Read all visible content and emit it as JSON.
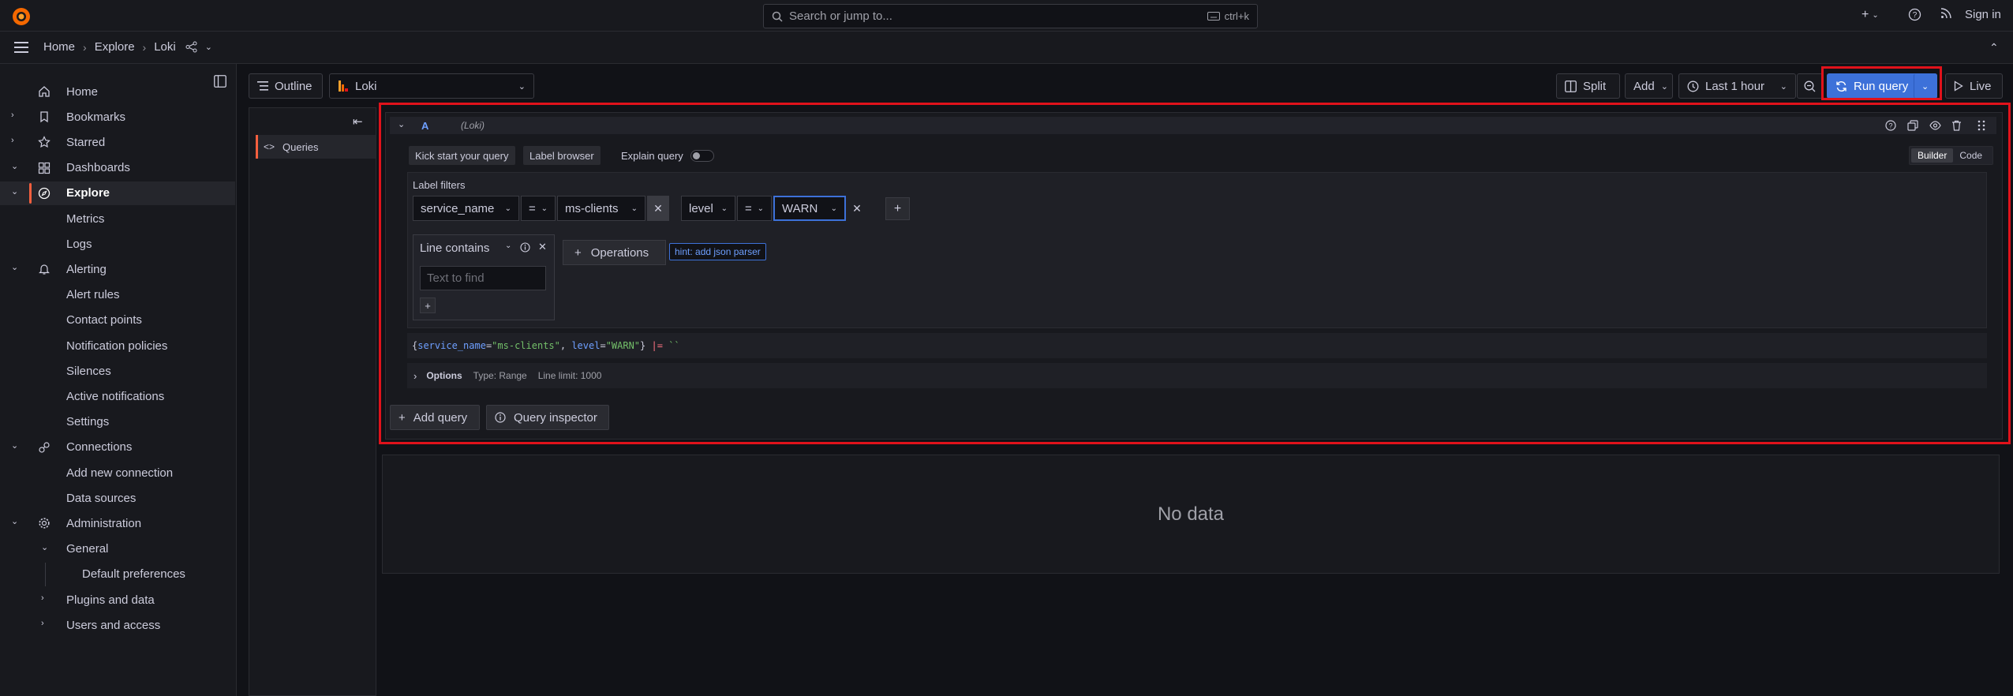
{
  "topbar": {
    "search_placeholder": "Search or jump to...",
    "search_shortcut": "ctrl+k",
    "sign_in": "Sign in"
  },
  "breadcrumb": [
    "Home",
    "Explore",
    "Loki"
  ],
  "sidebar": {
    "items": [
      {
        "label": "Home",
        "icon": "home-icon",
        "level": 0,
        "chevron": ""
      },
      {
        "label": "Bookmarks",
        "icon": "bookmark-icon",
        "level": 0,
        "chevron": "right"
      },
      {
        "label": "Starred",
        "icon": "star-icon",
        "level": 0,
        "chevron": "right"
      },
      {
        "label": "Dashboards",
        "icon": "dashboards-icon",
        "level": 0,
        "chevron": "down"
      },
      {
        "label": "Explore",
        "icon": "compass-icon",
        "level": 0,
        "chevron": "down",
        "active": true
      },
      {
        "label": "Metrics",
        "level": 1
      },
      {
        "label": "Logs",
        "level": 1
      },
      {
        "label": "Alerting",
        "icon": "bell-icon",
        "level": 0,
        "chevron": "down"
      },
      {
        "label": "Alert rules",
        "level": 1
      },
      {
        "label": "Contact points",
        "level": 1
      },
      {
        "label": "Notification policies",
        "level": 1
      },
      {
        "label": "Silences",
        "level": 1
      },
      {
        "label": "Active notifications",
        "level": 1
      },
      {
        "label": "Settings",
        "level": 1
      },
      {
        "label": "Connections",
        "icon": "connections-icon",
        "level": 0,
        "chevron": "down"
      },
      {
        "label": "Add new connection",
        "level": 1
      },
      {
        "label": "Data sources",
        "level": 1
      },
      {
        "label": "Administration",
        "icon": "gear-icon",
        "level": 0,
        "chevron": "down"
      },
      {
        "label": "General",
        "level": 1,
        "chevron": "down"
      },
      {
        "label": "Default preferences",
        "level": 2
      },
      {
        "label": "Plugins and data",
        "level": 1,
        "chevron": "right"
      },
      {
        "label": "Users and access",
        "level": 1,
        "chevron": "right"
      }
    ]
  },
  "toolbar": {
    "outline": "Outline",
    "datasource": "Loki",
    "split": "Split",
    "add": "Add",
    "time_range": "Last 1 hour",
    "run_query": "Run query",
    "live": "Live"
  },
  "outline_panel": {
    "queries": "Queries"
  },
  "query": {
    "ref_id": "A",
    "datasource": "(Loki)",
    "kick_start": "Kick start your query",
    "label_browser": "Label browser",
    "explain_query": "Explain query",
    "mode_builder": "Builder",
    "mode_code": "Code",
    "label_filters_title": "Label filters",
    "filters": [
      {
        "label": "service_name",
        "op": "=",
        "value": "ms-clients"
      },
      {
        "label": "level",
        "op": "=",
        "value": "WARN"
      }
    ],
    "line_contains": "Line contains",
    "text_to_find_placeholder": "Text to find",
    "operations": "Operations",
    "hint": "hint: add json parser",
    "raw_query": {
      "open": "{",
      "k1": "service_name",
      "eq1": "=",
      "v1": "\"ms-clients\"",
      "comma": ", ",
      "k2": "level",
      "eq2": "=",
      "v2": "\"WARN\"",
      "close": "}",
      "op": " |= ",
      "str": "``"
    },
    "options_label": "Options",
    "options_type": "Type: Range",
    "options_limit": "Line limit: 1000",
    "add_query": "Add query",
    "query_inspector": "Query inspector"
  },
  "results": {
    "no_data": "No data"
  },
  "colors": {
    "accent": "#3d71d9",
    "highlight": "#e0121b",
    "active_bar": "#f55f3e"
  }
}
